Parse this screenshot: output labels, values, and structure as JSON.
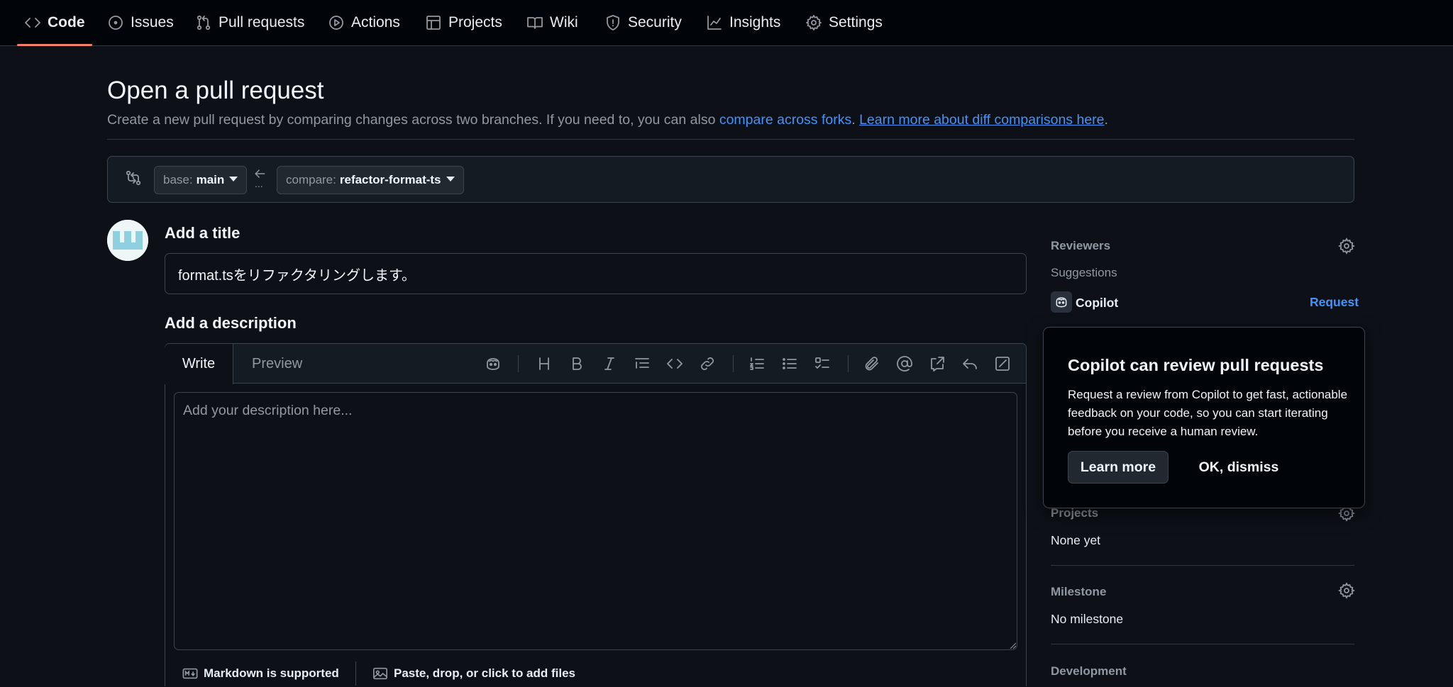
{
  "nav": {
    "tabs": [
      {
        "label": "Code",
        "icon": "code-icon"
      },
      {
        "label": "Issues",
        "icon": "issue-opened-icon"
      },
      {
        "label": "Pull requests",
        "icon": "git-pull-request-icon"
      },
      {
        "label": "Actions",
        "icon": "play-icon"
      },
      {
        "label": "Projects",
        "icon": "table-icon"
      },
      {
        "label": "Wiki",
        "icon": "book-icon"
      },
      {
        "label": "Security",
        "icon": "shield-icon"
      },
      {
        "label": "Insights",
        "icon": "graph-icon"
      },
      {
        "label": "Settings",
        "icon": "gear-icon"
      }
    ],
    "active": "Code"
  },
  "header": {
    "title": "Open a pull request",
    "subtitle_text": "Create a new pull request by comparing changes across two branches. If you need to, you can also ",
    "compare_forks_link": "compare across forks",
    "separator": ". ",
    "learn_more_link": "Learn more about diff comparisons here",
    "end": "."
  },
  "branches": {
    "base_label": "base:",
    "base_value": "main",
    "compare_label": "compare:",
    "compare_value": "refactor-format-ts",
    "arrow_dots": "..."
  },
  "form": {
    "title_label": "Add a title",
    "title_value": "format.tsをリファクタリングします。",
    "description_label": "Add a description",
    "tabs": {
      "write": "Write",
      "preview": "Preview"
    },
    "description_placeholder": "Add your description here...",
    "footer": {
      "markdown": "Markdown is supported",
      "attach": "Paste, drop, or click to add files"
    }
  },
  "sidebar": {
    "reviewers": {
      "heading": "Reviewers",
      "suggestions": "Suggestions",
      "suggested_name": "Copilot",
      "request_label": "Request"
    },
    "projects": {
      "heading": "Projects",
      "value": "None yet"
    },
    "milestone": {
      "heading": "Milestone",
      "value": "No milestone"
    },
    "development": {
      "heading": "Development"
    }
  },
  "popover": {
    "title": "Copilot can review pull requests",
    "body": "Request a review from Copilot to get fast, actionable feedback on your code, so you can start iterating before you receive a human review.",
    "learn_more": "Learn more",
    "dismiss": "OK, dismiss"
  },
  "colors": {
    "background": "#0d1117",
    "link": "#4493f8",
    "active_tab_underline": "#f78166",
    "border": "#3d444d"
  }
}
